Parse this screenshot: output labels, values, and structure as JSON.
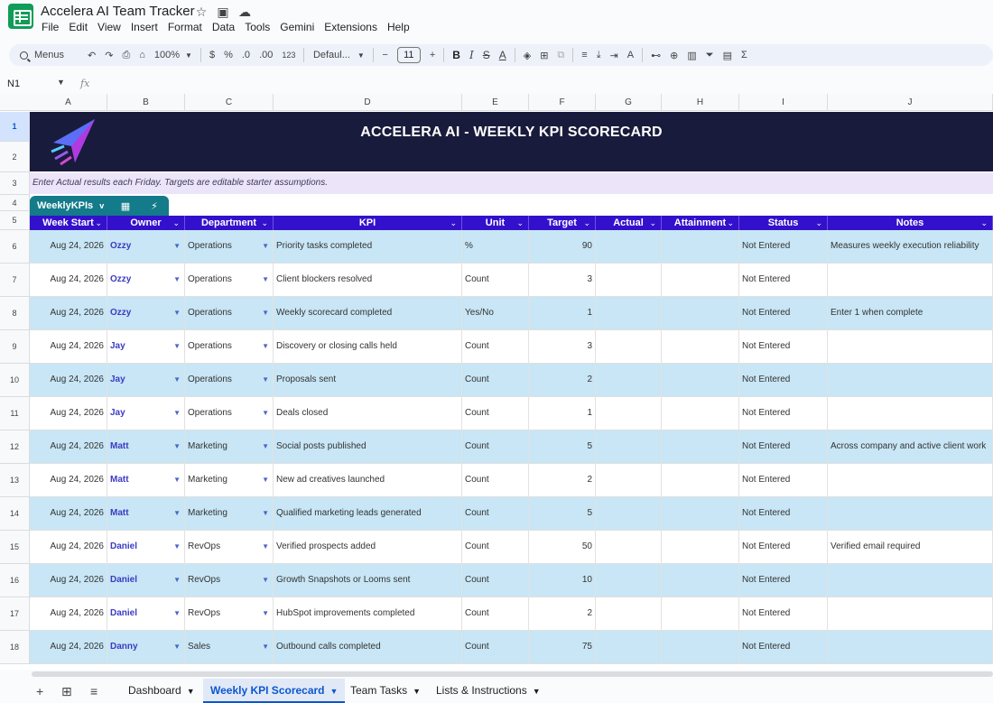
{
  "app": {
    "title": "Accelera AI Team Tracker",
    "menus": [
      "File",
      "Edit",
      "View",
      "Insert",
      "Format",
      "Data",
      "Tools",
      "Gemini",
      "Extensions",
      "Help"
    ]
  },
  "toolbar": {
    "search_label": "Menus",
    "zoom": "100%",
    "currency": "$",
    "percent": "%",
    "dec_decrease": ".0",
    "dec_increase": ".00",
    "number_format": "123",
    "font": "Defaul...",
    "font_size": "11",
    "bold": "B",
    "italic": "I",
    "strike": "S",
    "text_color": "A"
  },
  "formula_bar": {
    "cell_ref": "N1",
    "fx": "fx"
  },
  "columns": [
    "A",
    "B",
    "C",
    "D",
    "E",
    "F",
    "G",
    "H",
    "I",
    "J"
  ],
  "rows": [
    "1",
    "2",
    "3",
    "4",
    "5",
    "6",
    "7",
    "8",
    "9",
    "10",
    "11",
    "12",
    "13",
    "14",
    "15",
    "16",
    "17",
    "18"
  ],
  "sheet": {
    "banner_title": "ACCELERA AI - WEEKLY KPI SCORECARD",
    "info_text": "Enter Actual results each Friday. Targets are editable starter assumptions.",
    "table_name": "WeeklyKPIs",
    "headers": [
      "Week Start",
      "Owner",
      "Department",
      "KPI",
      "Unit",
      "Target",
      "Actual",
      "Attainment",
      "Status",
      "Notes"
    ]
  },
  "kpi_rows": [
    {
      "week": "Aug 24, 2026",
      "owner": "Ozzy",
      "dept": "Operations",
      "kpi": "Priority tasks completed",
      "unit": "%",
      "target": "90",
      "actual": "",
      "attain": "",
      "status": "Not Entered",
      "notes": "Measures weekly execution reliability"
    },
    {
      "week": "Aug 24, 2026",
      "owner": "Ozzy",
      "dept": "Operations",
      "kpi": "Client blockers resolved",
      "unit": "Count",
      "target": "3",
      "actual": "",
      "attain": "",
      "status": "Not Entered",
      "notes": ""
    },
    {
      "week": "Aug 24, 2026",
      "owner": "Ozzy",
      "dept": "Operations",
      "kpi": "Weekly scorecard completed",
      "unit": "Yes/No",
      "target": "1",
      "actual": "",
      "attain": "",
      "status": "Not Entered",
      "notes": "Enter 1 when complete"
    },
    {
      "week": "Aug 24, 2026",
      "owner": "Jay",
      "dept": "Operations",
      "kpi": "Discovery or closing calls held",
      "unit": "Count",
      "target": "3",
      "actual": "",
      "attain": "",
      "status": "Not Entered",
      "notes": ""
    },
    {
      "week": "Aug 24, 2026",
      "owner": "Jay",
      "dept": "Operations",
      "kpi": "Proposals sent",
      "unit": "Count",
      "target": "2",
      "actual": "",
      "attain": "",
      "status": "Not Entered",
      "notes": ""
    },
    {
      "week": "Aug 24, 2026",
      "owner": "Jay",
      "dept": "Operations",
      "kpi": "Deals closed",
      "unit": "Count",
      "target": "1",
      "actual": "",
      "attain": "",
      "status": "Not Entered",
      "notes": ""
    },
    {
      "week": "Aug 24, 2026",
      "owner": "Matt",
      "dept": "Marketing",
      "kpi": "Social posts published",
      "unit": "Count",
      "target": "5",
      "actual": "",
      "attain": "",
      "status": "Not Entered",
      "notes": "Across company and active client work"
    },
    {
      "week": "Aug 24, 2026",
      "owner": "Matt",
      "dept": "Marketing",
      "kpi": "New ad creatives launched",
      "unit": "Count",
      "target": "2",
      "actual": "",
      "attain": "",
      "status": "Not Entered",
      "notes": ""
    },
    {
      "week": "Aug 24, 2026",
      "owner": "Matt",
      "dept": "Marketing",
      "kpi": "Qualified marketing leads generated",
      "unit": "Count",
      "target": "5",
      "actual": "",
      "attain": "",
      "status": "Not Entered",
      "notes": ""
    },
    {
      "week": "Aug 24, 2026",
      "owner": "Daniel",
      "dept": "RevOps",
      "kpi": "Verified prospects added",
      "unit": "Count",
      "target": "50",
      "actual": "",
      "attain": "",
      "status": "Not Entered",
      "notes": "Verified email required"
    },
    {
      "week": "Aug 24, 2026",
      "owner": "Daniel",
      "dept": "RevOps",
      "kpi": "Growth Snapshots or Looms sent",
      "unit": "Count",
      "target": "10",
      "actual": "",
      "attain": "",
      "status": "Not Entered",
      "notes": ""
    },
    {
      "week": "Aug 24, 2026",
      "owner": "Daniel",
      "dept": "RevOps",
      "kpi": "HubSpot improvements completed",
      "unit": "Count",
      "target": "2",
      "actual": "",
      "attain": "",
      "status": "Not Entered",
      "notes": ""
    },
    {
      "week": "Aug 24, 2026",
      "owner": "Danny",
      "dept": "Sales",
      "kpi": "Outbound calls completed",
      "unit": "Count",
      "target": "75",
      "actual": "",
      "attain": "",
      "status": "Not Entered",
      "notes": ""
    }
  ],
  "sheet_tabs": [
    "Dashboard",
    "Weekly KPI Scorecard",
    "Team Tasks",
    "Lists & Instructions"
  ],
  "active_tab": "Weekly KPI Scorecard",
  "colors": {
    "banner_bg": "#191b3c",
    "header_bg": "#3311cc",
    "table_tab_bg": "#137b8a",
    "alt_row_bg": "#c8e6f5",
    "info_bg": "#ece5fa"
  }
}
